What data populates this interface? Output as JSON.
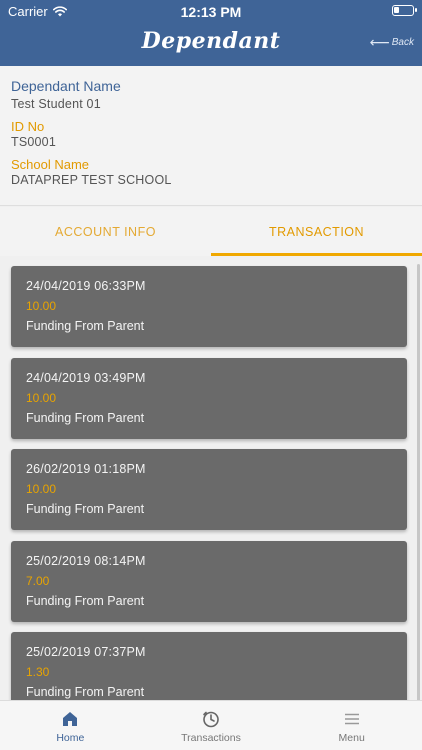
{
  "status_bar": {
    "carrier": "Carrier",
    "time": "12:13 PM"
  },
  "header": {
    "title": "Dependant",
    "back_label": "Back"
  },
  "dependant": {
    "name_label": "Dependant Name",
    "name_value": "Test Student 01",
    "id_label": "ID No",
    "id_value": "TS0001",
    "school_label": "School Name",
    "school_value": "DATAPREP TEST SCHOOL"
  },
  "tabs": [
    {
      "label": "ACCOUNT INFO",
      "active": false
    },
    {
      "label": "TRANSACTION",
      "active": true
    }
  ],
  "transactions": [
    {
      "date": "24/04/2019 06:33PM",
      "amount": "10.00",
      "description": "Funding From Parent"
    },
    {
      "date": "24/04/2019 03:49PM",
      "amount": "10.00",
      "description": "Funding From Parent"
    },
    {
      "date": "26/02/2019 01:18PM",
      "amount": "10.00",
      "description": "Funding From Parent"
    },
    {
      "date": "25/02/2019 08:14PM",
      "amount": "7.00",
      "description": "Funding From Parent"
    },
    {
      "date": "25/02/2019 07:37PM",
      "amount": "1.30",
      "description": "Funding From Parent"
    }
  ],
  "bottom_nav": [
    {
      "label": "Home",
      "icon": "home-icon",
      "active": true
    },
    {
      "label": "Transactions",
      "icon": "clock-icon",
      "active": false
    },
    {
      "label": "Menu",
      "icon": "menu-icon",
      "active": false
    }
  ],
  "colors": {
    "header": "#3f6497",
    "accent": "#e29a00",
    "card": "#6a6a6a"
  }
}
